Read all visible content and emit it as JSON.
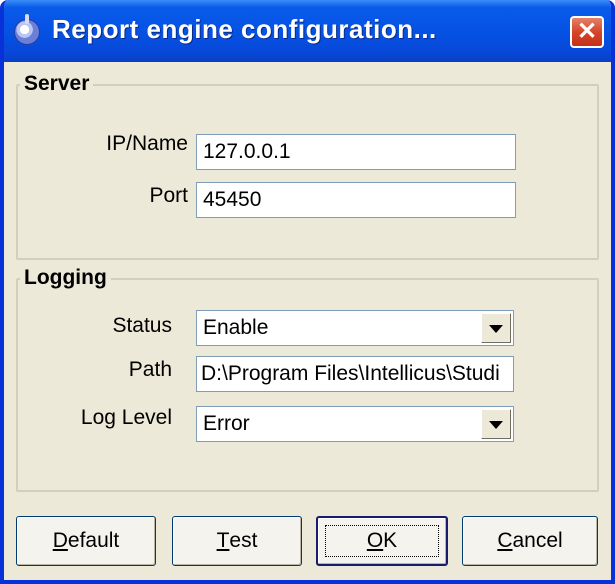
{
  "window": {
    "title": "Report engine configuration...",
    "close_glyph": "✕",
    "app_icon": "app-icon",
    "colors": {
      "titlebar": "#0552e4",
      "face": "#ece9d8",
      "close": "#d6452a"
    }
  },
  "server": {
    "legend": "Server",
    "ip_label": "IP/Name",
    "ip_value": "127.0.0.1",
    "port_label": "Port",
    "port_value": "45450"
  },
  "logging": {
    "legend": "Logging",
    "status_label": "Status",
    "status_value": "Enable",
    "path_label": "Path",
    "path_value": "D:\\Program Files\\Intellicus\\Studi",
    "level_label": "Log Level",
    "level_value": "Error"
  },
  "buttons": {
    "default_first": "D",
    "default_rest": "efault",
    "test_first": "T",
    "test_rest": "est",
    "ok_first": "O",
    "ok_rest": "K",
    "cancel_first": "C",
    "cancel_rest": "ancel"
  }
}
